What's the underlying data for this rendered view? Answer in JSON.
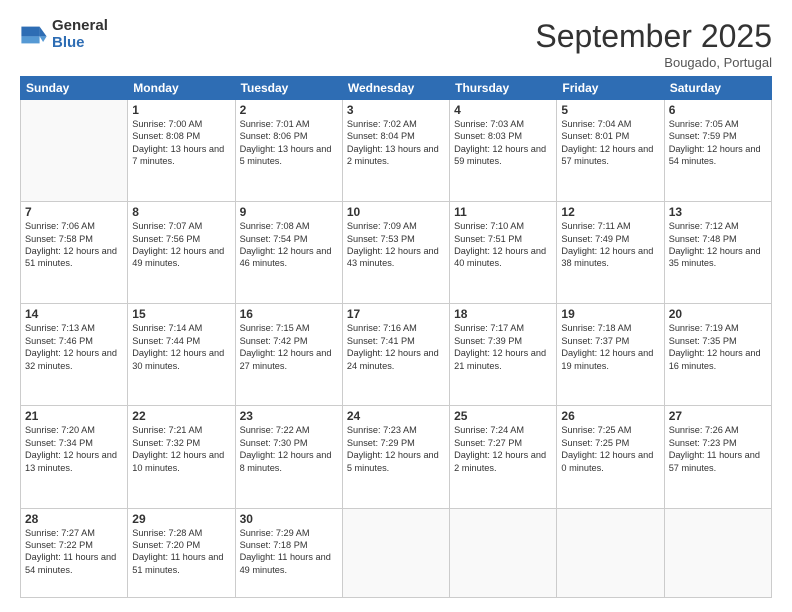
{
  "logo": {
    "general": "General",
    "blue": "Blue"
  },
  "header": {
    "month": "September 2025",
    "location": "Bougado, Portugal"
  },
  "weekdays": [
    "Sunday",
    "Monday",
    "Tuesday",
    "Wednesday",
    "Thursday",
    "Friday",
    "Saturday"
  ],
  "weeks": [
    [
      {
        "day": "",
        "sunrise": "",
        "sunset": "",
        "daylight": ""
      },
      {
        "day": "1",
        "sunrise": "Sunrise: 7:00 AM",
        "sunset": "Sunset: 8:08 PM",
        "daylight": "Daylight: 13 hours and 7 minutes."
      },
      {
        "day": "2",
        "sunrise": "Sunrise: 7:01 AM",
        "sunset": "Sunset: 8:06 PM",
        "daylight": "Daylight: 13 hours and 5 minutes."
      },
      {
        "day": "3",
        "sunrise": "Sunrise: 7:02 AM",
        "sunset": "Sunset: 8:04 PM",
        "daylight": "Daylight: 13 hours and 2 minutes."
      },
      {
        "day": "4",
        "sunrise": "Sunrise: 7:03 AM",
        "sunset": "Sunset: 8:03 PM",
        "daylight": "Daylight: 12 hours and 59 minutes."
      },
      {
        "day": "5",
        "sunrise": "Sunrise: 7:04 AM",
        "sunset": "Sunset: 8:01 PM",
        "daylight": "Daylight: 12 hours and 57 minutes."
      },
      {
        "day": "6",
        "sunrise": "Sunrise: 7:05 AM",
        "sunset": "Sunset: 7:59 PM",
        "daylight": "Daylight: 12 hours and 54 minutes."
      }
    ],
    [
      {
        "day": "7",
        "sunrise": "Sunrise: 7:06 AM",
        "sunset": "Sunset: 7:58 PM",
        "daylight": "Daylight: 12 hours and 51 minutes."
      },
      {
        "day": "8",
        "sunrise": "Sunrise: 7:07 AM",
        "sunset": "Sunset: 7:56 PM",
        "daylight": "Daylight: 12 hours and 49 minutes."
      },
      {
        "day": "9",
        "sunrise": "Sunrise: 7:08 AM",
        "sunset": "Sunset: 7:54 PM",
        "daylight": "Daylight: 12 hours and 46 minutes."
      },
      {
        "day": "10",
        "sunrise": "Sunrise: 7:09 AM",
        "sunset": "Sunset: 7:53 PM",
        "daylight": "Daylight: 12 hours and 43 minutes."
      },
      {
        "day": "11",
        "sunrise": "Sunrise: 7:10 AM",
        "sunset": "Sunset: 7:51 PM",
        "daylight": "Daylight: 12 hours and 40 minutes."
      },
      {
        "day": "12",
        "sunrise": "Sunrise: 7:11 AM",
        "sunset": "Sunset: 7:49 PM",
        "daylight": "Daylight: 12 hours and 38 minutes."
      },
      {
        "day": "13",
        "sunrise": "Sunrise: 7:12 AM",
        "sunset": "Sunset: 7:48 PM",
        "daylight": "Daylight: 12 hours and 35 minutes."
      }
    ],
    [
      {
        "day": "14",
        "sunrise": "Sunrise: 7:13 AM",
        "sunset": "Sunset: 7:46 PM",
        "daylight": "Daylight: 12 hours and 32 minutes."
      },
      {
        "day": "15",
        "sunrise": "Sunrise: 7:14 AM",
        "sunset": "Sunset: 7:44 PM",
        "daylight": "Daylight: 12 hours and 30 minutes."
      },
      {
        "day": "16",
        "sunrise": "Sunrise: 7:15 AM",
        "sunset": "Sunset: 7:42 PM",
        "daylight": "Daylight: 12 hours and 27 minutes."
      },
      {
        "day": "17",
        "sunrise": "Sunrise: 7:16 AM",
        "sunset": "Sunset: 7:41 PM",
        "daylight": "Daylight: 12 hours and 24 minutes."
      },
      {
        "day": "18",
        "sunrise": "Sunrise: 7:17 AM",
        "sunset": "Sunset: 7:39 PM",
        "daylight": "Daylight: 12 hours and 21 minutes."
      },
      {
        "day": "19",
        "sunrise": "Sunrise: 7:18 AM",
        "sunset": "Sunset: 7:37 PM",
        "daylight": "Daylight: 12 hours and 19 minutes."
      },
      {
        "day": "20",
        "sunrise": "Sunrise: 7:19 AM",
        "sunset": "Sunset: 7:35 PM",
        "daylight": "Daylight: 12 hours and 16 minutes."
      }
    ],
    [
      {
        "day": "21",
        "sunrise": "Sunrise: 7:20 AM",
        "sunset": "Sunset: 7:34 PM",
        "daylight": "Daylight: 12 hours and 13 minutes."
      },
      {
        "day": "22",
        "sunrise": "Sunrise: 7:21 AM",
        "sunset": "Sunset: 7:32 PM",
        "daylight": "Daylight: 12 hours and 10 minutes."
      },
      {
        "day": "23",
        "sunrise": "Sunrise: 7:22 AM",
        "sunset": "Sunset: 7:30 PM",
        "daylight": "Daylight: 12 hours and 8 minutes."
      },
      {
        "day": "24",
        "sunrise": "Sunrise: 7:23 AM",
        "sunset": "Sunset: 7:29 PM",
        "daylight": "Daylight: 12 hours and 5 minutes."
      },
      {
        "day": "25",
        "sunrise": "Sunrise: 7:24 AM",
        "sunset": "Sunset: 7:27 PM",
        "daylight": "Daylight: 12 hours and 2 minutes."
      },
      {
        "day": "26",
        "sunrise": "Sunrise: 7:25 AM",
        "sunset": "Sunset: 7:25 PM",
        "daylight": "Daylight: 12 hours and 0 minutes."
      },
      {
        "day": "27",
        "sunrise": "Sunrise: 7:26 AM",
        "sunset": "Sunset: 7:23 PM",
        "daylight": "Daylight: 11 hours and 57 minutes."
      }
    ],
    [
      {
        "day": "28",
        "sunrise": "Sunrise: 7:27 AM",
        "sunset": "Sunset: 7:22 PM",
        "daylight": "Daylight: 11 hours and 54 minutes."
      },
      {
        "day": "29",
        "sunrise": "Sunrise: 7:28 AM",
        "sunset": "Sunset: 7:20 PM",
        "daylight": "Daylight: 11 hours and 51 minutes."
      },
      {
        "day": "30",
        "sunrise": "Sunrise: 7:29 AM",
        "sunset": "Sunset: 7:18 PM",
        "daylight": "Daylight: 11 hours and 49 minutes."
      },
      {
        "day": "",
        "sunrise": "",
        "sunset": "",
        "daylight": ""
      },
      {
        "day": "",
        "sunrise": "",
        "sunset": "",
        "daylight": ""
      },
      {
        "day": "",
        "sunrise": "",
        "sunset": "",
        "daylight": ""
      },
      {
        "day": "",
        "sunrise": "",
        "sunset": "",
        "daylight": ""
      }
    ]
  ]
}
